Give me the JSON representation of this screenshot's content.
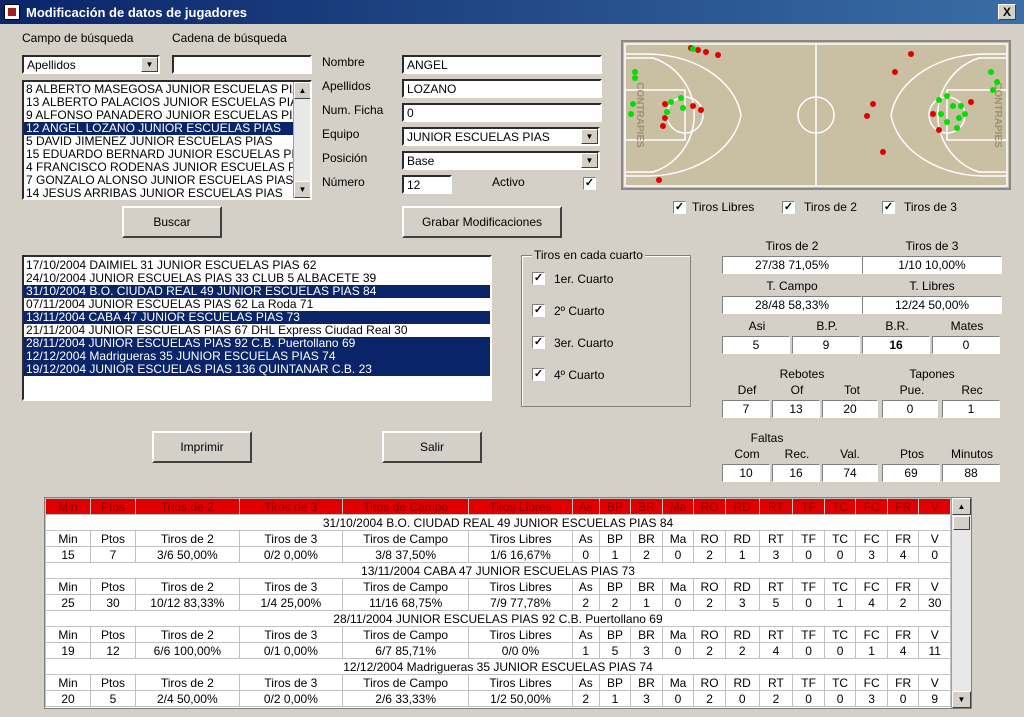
{
  "window": {
    "title": "Modificación de datos de jugadores",
    "close": "X"
  },
  "search": {
    "field_label": "Campo de búsqueda",
    "string_label": "Cadena de búsqueda",
    "field_value": "Apellidos",
    "string_value": "",
    "button": "Buscar"
  },
  "players": [
    "8   ALBERTO MASEGOSA JUNIOR ESCUELAS PIAS",
    "13  ALBERTO PALACIOS JUNIOR ESCUELAS PIAS",
    "9   ALFONSO PANADERO JUNIOR ESCUELAS PIAS",
    "12  ANGEL LOZANO JUNIOR ESCUELAS PIAS",
    "5   DAVID JIMENEZ JUNIOR ESCUELAS PIAS",
    "15  EDUARDO BERNARD JUNIOR ESCUELAS PIAS",
    "4   FRANCISCO RODENAS JUNIOR ESCUELAS PIAS",
    "7   GONZALO ALONSO JUNIOR ESCUELAS PIAS",
    "14  JESUS ARRIBAS JUNIOR ESCUELAS PIAS"
  ],
  "selected_player_index": 3,
  "form": {
    "nombre_label": "Nombre",
    "nombre": "ANGEL",
    "apellidos_label": "Apellidos",
    "apellidos": "LOZANO",
    "ficha_label": "Num. Ficha",
    "ficha": "0",
    "equipo_label": "Equipo",
    "equipo": "JUNIOR ESCUELAS PIAS",
    "posicion_label": "Posición",
    "posicion": "Base",
    "numero_label": "Número",
    "numero": "12",
    "activo_label": "Activo",
    "activo": "✓",
    "save_button": "Grabar Modificaciones"
  },
  "court": {
    "left_text": "CONTRAPIES",
    "right_text": "CONTRAPIES"
  },
  "shot_filters": [
    {
      "label": "Tiros Libres",
      "checked": "✓"
    },
    {
      "label": "Tiros de 2",
      "checked": "✓"
    },
    {
      "label": "Tiros de 3",
      "checked": "✓"
    }
  ],
  "games": [
    {
      "text": "17/10/2004 DAIMIEL 31 JUNIOR ESCUELAS PIAS 62",
      "selected": false
    },
    {
      "text": "24/10/2004 JUNIOR ESCUELAS PIAS 33 CLUB 5 ALBACETE 39",
      "selected": false
    },
    {
      "text": "31/10/2004 B.O. CIUDAD REAL 49 JUNIOR ESCUELAS PIAS 84",
      "selected": true
    },
    {
      "text": "07/11/2004 JUNIOR ESCUELAS PIAS 62 La Roda 71",
      "selected": false
    },
    {
      "text": "13/11/2004 CABA 47 JUNIOR ESCUELAS PIAS 73",
      "selected": true
    },
    {
      "text": "21/11/2004 JUNIOR ESCUELAS PIAS 67 DHL Express Ciudad Real 30",
      "selected": false
    },
    {
      "text": "28/11/2004 JUNIOR ESCUELAS PIAS 92 C.B. Puertollano 69",
      "selected": true
    },
    {
      "text": "12/12/2004 Madrigueras 35 JUNIOR ESCUELAS PIAS 74",
      "selected": true
    },
    {
      "text": "19/12/2004 JUNIOR ESCUELAS PIAS 136 QUINTANAR C.B. 23",
      "selected": true
    }
  ],
  "quarters": {
    "title": "Tiros en cada cuarto",
    "items": [
      {
        "label": "1er. Cuarto",
        "checked": "✓"
      },
      {
        "label": "2º Cuarto",
        "checked": "✓"
      },
      {
        "label": "3er. Cuarto",
        "checked": "✓"
      },
      {
        "label": "4º Cuarto",
        "checked": "✓"
      }
    ]
  },
  "buttons": {
    "print": "Imprimir",
    "exit": "Salir"
  },
  "stats": {
    "t2_label": "Tiros de 2",
    "t2": "27/38 71,05%",
    "t3_label": "Tiros de 3",
    "t3": "1/10 10,00%",
    "tc_label": "T. Campo",
    "tc": "28/48 58,33%",
    "tl_label": "T. Libres",
    "tl": "12/24 50,00%",
    "asi_label": "Asi",
    "asi": "5",
    "bp_label": "B.P.",
    "bp": "9",
    "br_label": "B.R.",
    "br": "16",
    "mates_label": "Mates",
    "mates": "0",
    "rebotes_label": "Rebotes",
    "tapones_label": "Tapones",
    "def_label": "Def",
    "def": "7",
    "of_label": "Of",
    "of": "13",
    "tot_label": "Tot",
    "tot": "20",
    "pue_label": "Pue.",
    "pue": "0",
    "rec_label": "Rec",
    "rec": "1",
    "faltas_label": "Faltas",
    "com_label": "Com",
    "com": "10",
    "frec_label": "Rec.",
    "frec": "16",
    "val_label": "Val.",
    "val": "74",
    "ptos_label": "Ptos",
    "ptos": "69",
    "min_label": "Minutos",
    "min": "88"
  },
  "grid": {
    "header": [
      "Min",
      "Ptos",
      "Tiros de 2",
      "Tiros de 3",
      "Tiros de Campo",
      "Tiros Libres",
      "As",
      "BP",
      "BR",
      "Ma",
      "RO",
      "RD",
      "RT",
      "TF",
      "TC",
      "FC",
      "FR",
      "V"
    ],
    "games": [
      {
        "title": "31/10/2004 B.O. CIUDAD REAL 49 JUNIOR ESCUELAS PIAS 84",
        "row": [
          "15",
          "7",
          "3/6 50,00%",
          "0/2 0,00%",
          "3/8 37,50%",
          "1/6 16,67%",
          "0",
          "1",
          "2",
          "0",
          "2",
          "1",
          "3",
          "0",
          "0",
          "3",
          "4",
          "0"
        ]
      },
      {
        "title": "13/11/2004 CABA 47 JUNIOR ESCUELAS PIAS 73",
        "row": [
          "25",
          "30",
          "10/12 83,33%",
          "1/4 25,00%",
          "11/16 68,75%",
          "7/9 77,78%",
          "2",
          "2",
          "1",
          "0",
          "2",
          "3",
          "5",
          "0",
          "1",
          "4",
          "2",
          "30"
        ]
      },
      {
        "title": "28/11/2004 JUNIOR ESCUELAS PIAS 92 C.B. Puertollano 69",
        "row": [
          "19",
          "12",
          "6/6 100,00%",
          "0/1 0,00%",
          "6/7 85,71%",
          "0/0 0%",
          "1",
          "5",
          "3",
          "0",
          "2",
          "2",
          "4",
          "0",
          "0",
          "1",
          "4",
          "11"
        ]
      },
      {
        "title": "12/12/2004 Madrigueras 35 JUNIOR ESCUELAS PIAS 74",
        "row": [
          "20",
          "5",
          "2/4 50,00%",
          "0/2 0,00%",
          "2/6 33,33%",
          "1/2 50,00%",
          "2",
          "1",
          "3",
          "0",
          "2",
          "0",
          "2",
          "0",
          "0",
          "3",
          "0",
          "9"
        ]
      }
    ]
  },
  "colors": {
    "selection": "#0a246a",
    "made_shot": "#00e000",
    "missed_shot": "#e00000",
    "header_red": "#e00000"
  }
}
